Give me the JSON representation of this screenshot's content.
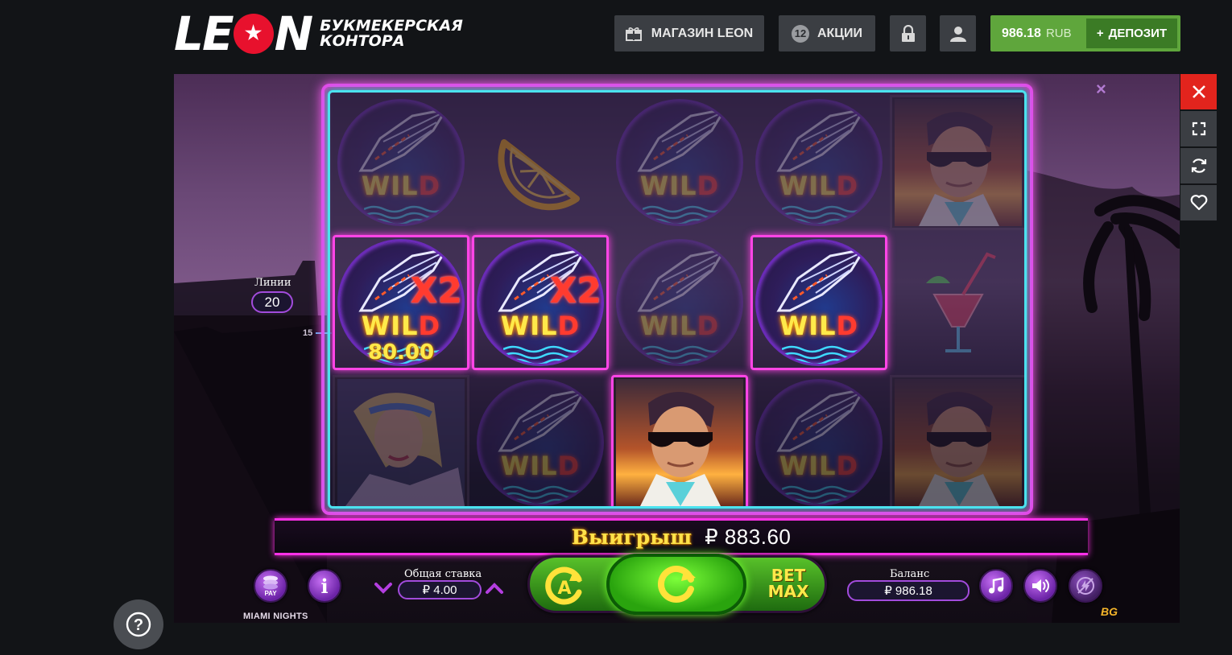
{
  "header": {
    "logo_text_1": "LE",
    "logo_text_2": "N",
    "logo_sub_1": "БУКМЕКЕРСКАЯ",
    "logo_sub_2": "КОНТОРА",
    "shop_label": "МАГАЗИН LEON",
    "promo_count": "12",
    "promo_label": "АКЦИИ",
    "balance_amount": "986.18",
    "balance_currency": "RUB",
    "deposit_label": "ДЕПОЗИТ",
    "deposit_plus": "+"
  },
  "side_tools": [
    "close-icon",
    "fullscreen-icon",
    "refresh-icon",
    "heart-icon"
  ],
  "game": {
    "close_glyph": "×",
    "lines_label": "Линии",
    "lines_value": "20",
    "line_number": "15",
    "reels": [
      [
        "wild",
        "lemon",
        "wild",
        "wild",
        "man"
      ],
      [
        "wild_x2",
        "wild_x2",
        "wild",
        "wild",
        "cocktail"
      ],
      [
        "woman",
        "wild",
        "man",
        "wild",
        "man"
      ]
    ],
    "wild_text_main": "WIL",
    "wild_text_d": "D",
    "multiplier": "X2",
    "cell_win_amount": "80.00",
    "win_label": "Выигрыш",
    "win_value": "₽ 883.60",
    "bet_label": "Общая ставка",
    "bet_value": "₽ 4.00",
    "balance_label": "Баланс",
    "balance_value": "₽ 986.18",
    "betmax_line1": "BET",
    "betmax_line2": "MAX",
    "pay_label": "PAY",
    "info_glyph": "i",
    "auto_glyph": "A",
    "game_title": "MIAMI NIGHTS",
    "provider_badge": "BG"
  },
  "help_glyph": "?"
}
